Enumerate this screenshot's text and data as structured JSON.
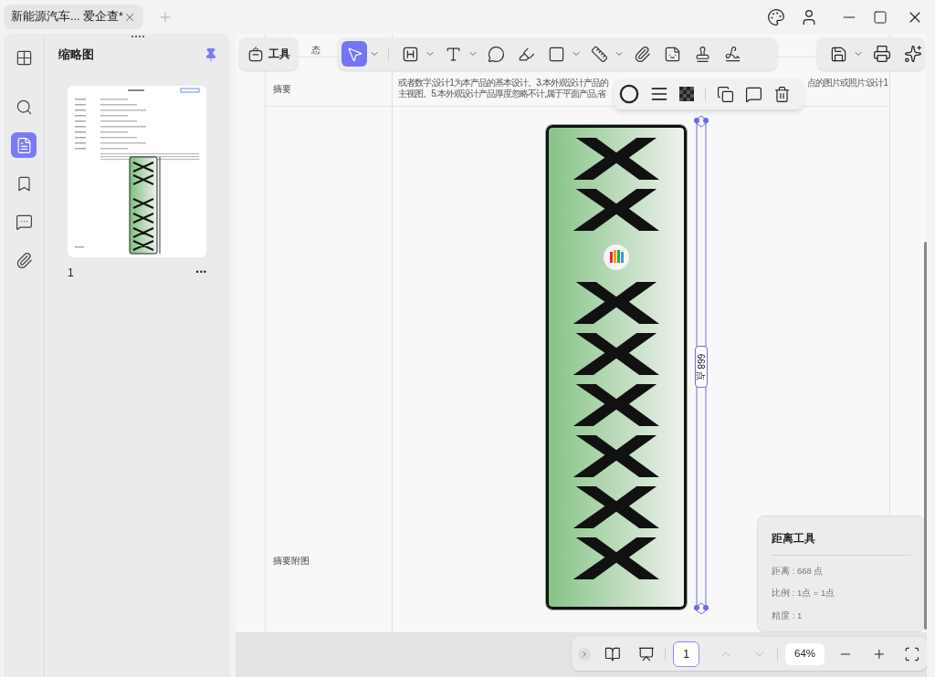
{
  "tab": {
    "title": "新能源汽车... 爱企查*"
  },
  "rail": [
    {
      "selected": false
    },
    {
      "selected": false
    },
    {
      "selected": true
    },
    {
      "selected": false
    },
    {
      "selected": false
    },
    {
      "selected": false
    }
  ],
  "thumbnails": {
    "title": "缩略图",
    "pinned": true,
    "pages": [
      {
        "number": "1",
        "selected": false,
        "more": "•••"
      }
    ]
  },
  "tools_button": "工具",
  "toolbar": [
    {
      "selected": true,
      "menu": true
    },
    {
      "selected": false,
      "menu": true
    },
    {
      "selected": false,
      "menu": true
    },
    {
      "selected": false,
      "menu": false
    },
    {
      "selected": false,
      "menu": false
    },
    {
      "selected": false,
      "menu": true
    },
    {
      "selected": false,
      "menu": true
    },
    {
      "selected": false,
      "menu": false
    },
    {
      "selected": false,
      "menu": false
    },
    {
      "selected": false,
      "menu": false
    },
    {
      "selected": false,
      "menu": false
    }
  ],
  "document": {
    "rows": [
      {
        "label": "态"
      },
      {
        "label": "摘要",
        "lines": [
          [
            "或者数字;设计1为本产品的基本设计。3.本外观设计产品的",
            "点的图片或照片:设计1"
          ],
          [
            "主视图。5.本外观设计产品厚度忽略不计,属于平面产品,省"
          ]
        ]
      },
      {
        "label": "摘要附图"
      }
    ],
    "plate": {
      "characters": [
        "X",
        "X",
        "X",
        "X",
        "X",
        "X",
        "X",
        "X"
      ]
    },
    "measure": "668 点"
  },
  "info_panel": {
    "title": "距离工具",
    "lines": [
      "距离 : 668 点",
      "比例 : 1点 = 1点",
      "精度 : 1"
    ]
  },
  "page_nav": {
    "page": "1",
    "zoom": "64%"
  }
}
